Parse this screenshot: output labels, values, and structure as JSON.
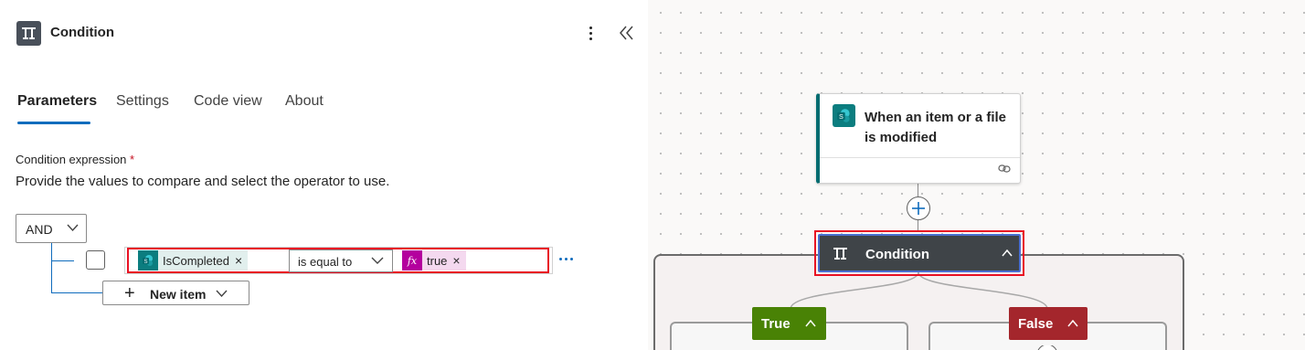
{
  "panel": {
    "title": "Condition",
    "tabs": [
      {
        "label": "Parameters",
        "active": true
      },
      {
        "label": "Settings",
        "active": false
      },
      {
        "label": "Code view",
        "active": false
      },
      {
        "label": "About",
        "active": false
      }
    ],
    "field_label": "Condition expression",
    "required_mark": "*",
    "field_description": "Provide the values to compare and select the operator to use.",
    "group_operator": "AND",
    "row": {
      "left_token": {
        "label": "IsCompleted",
        "icon": "sharepoint-icon",
        "color": "#0b7d7f"
      },
      "operator": "is equal to",
      "right_token": {
        "label": "true",
        "icon": "fx-icon",
        "color": "#b4009e"
      },
      "checked": false
    },
    "new_item_label": "New item"
  },
  "canvas": {
    "trigger": {
      "title": "When an item or a file is modified",
      "icon": "sharepoint-icon",
      "accent": "#036c70"
    },
    "condition_card": {
      "label": "Condition",
      "background": "#3f4448"
    },
    "branches": [
      {
        "label": "True",
        "color": "#498205"
      },
      {
        "label": "False",
        "color": "#a4262c"
      }
    ]
  },
  "colors": {
    "accent": "#0f6cbd",
    "highlight": "#e81123"
  }
}
